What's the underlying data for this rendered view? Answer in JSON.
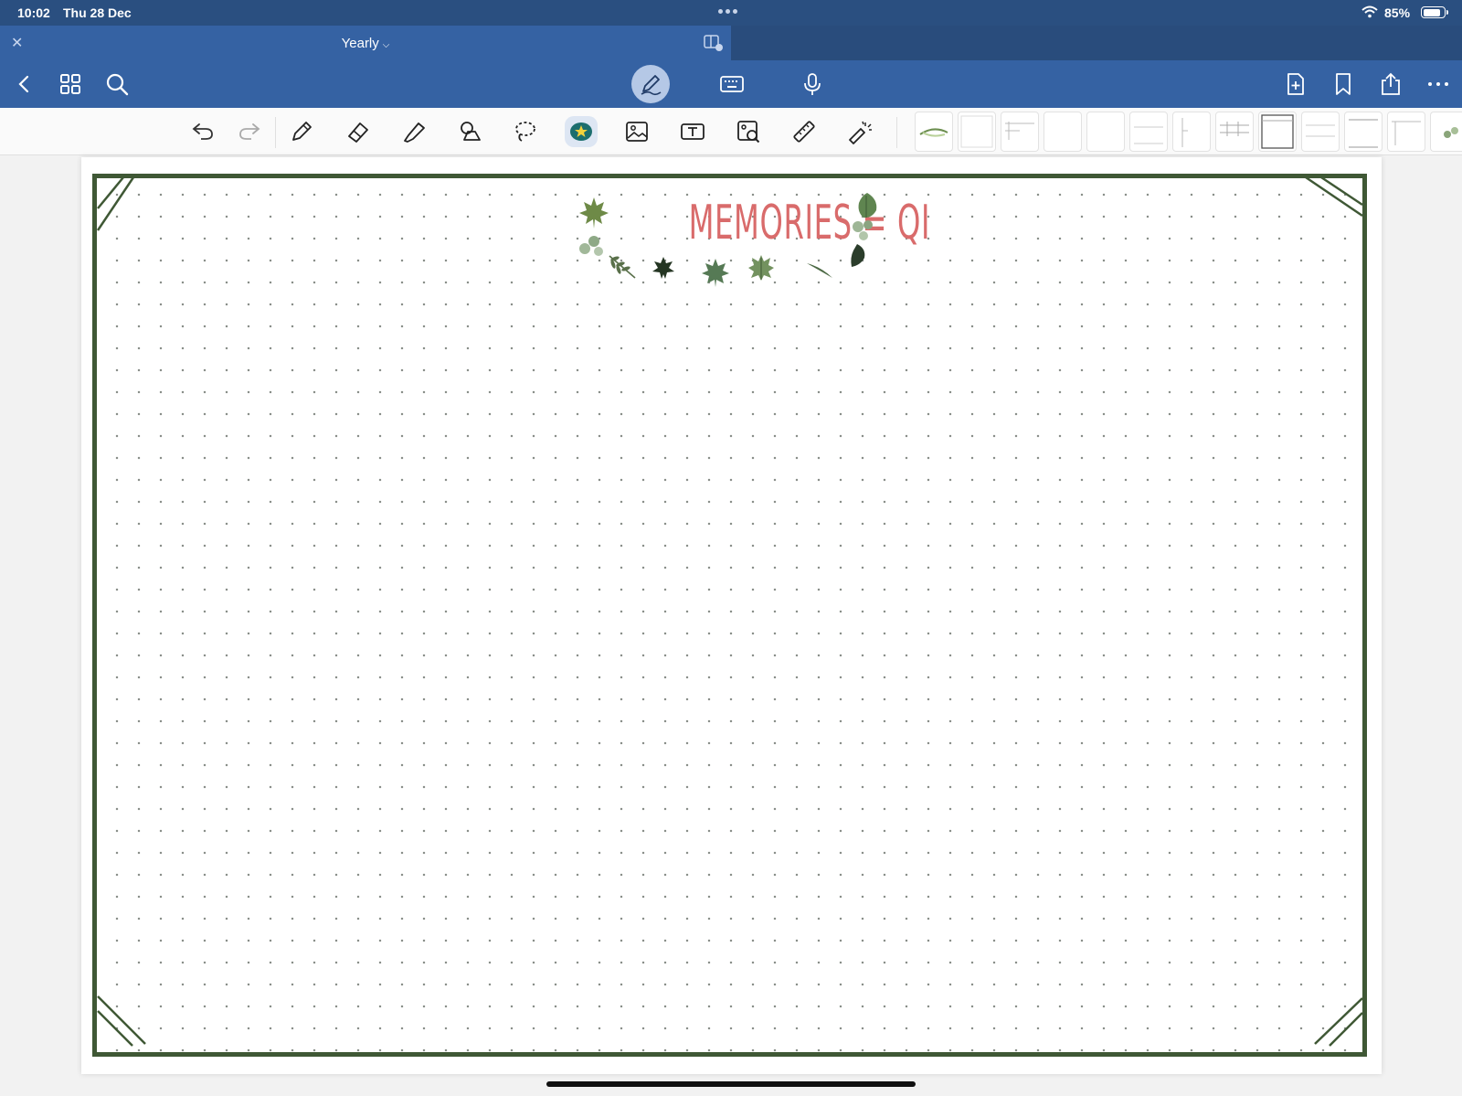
{
  "status_bar": {
    "time": "10:02",
    "date": "Thu 28 Dec",
    "battery": "85%"
  },
  "tab": {
    "title": "Yearly"
  },
  "page": {
    "title": "MEMORIES = QI"
  },
  "colors": {
    "nav_blue": "#3562a3",
    "status_blue": "#2a4f80",
    "frame_green": "#3f5835",
    "title_red": "#d96b6b"
  }
}
